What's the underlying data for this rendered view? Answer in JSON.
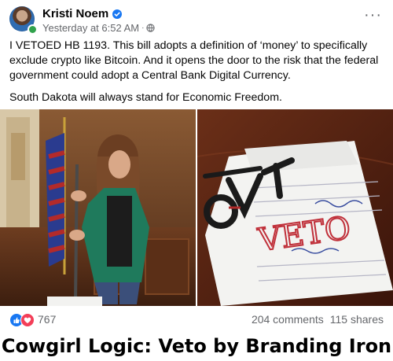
{
  "post": {
    "author": "Kristi Noem",
    "timestamp": "Yesterday at 6:52 AM",
    "separator": "·",
    "more_menu": "···",
    "paragraphs": [
      "I VETOED HB 1193. This bill adopts a definition of ‘money’ to specifically exclude crypto like Bitcoin. And it opens the door to the risk that the federal government could adopt a Central Bank Digital Currency.",
      "South Dakota will always stand for Economic Freedom."
    ],
    "icons": {
      "verified": "verified-badge-icon",
      "audience": "globe-icon",
      "reactions": [
        "like-icon",
        "love-icon"
      ]
    },
    "colors": {
      "brand_blue": "#1877f2",
      "love_red": "#f33e58",
      "meta_gray": "#65676b"
    }
  },
  "photos": {
    "right_overlay": "VETO"
  },
  "footer": {
    "reaction_count": "767",
    "comments": "204 comments",
    "shares": "115 shares"
  },
  "caption": "Cowgirl Logic: Veto by Branding Iron"
}
